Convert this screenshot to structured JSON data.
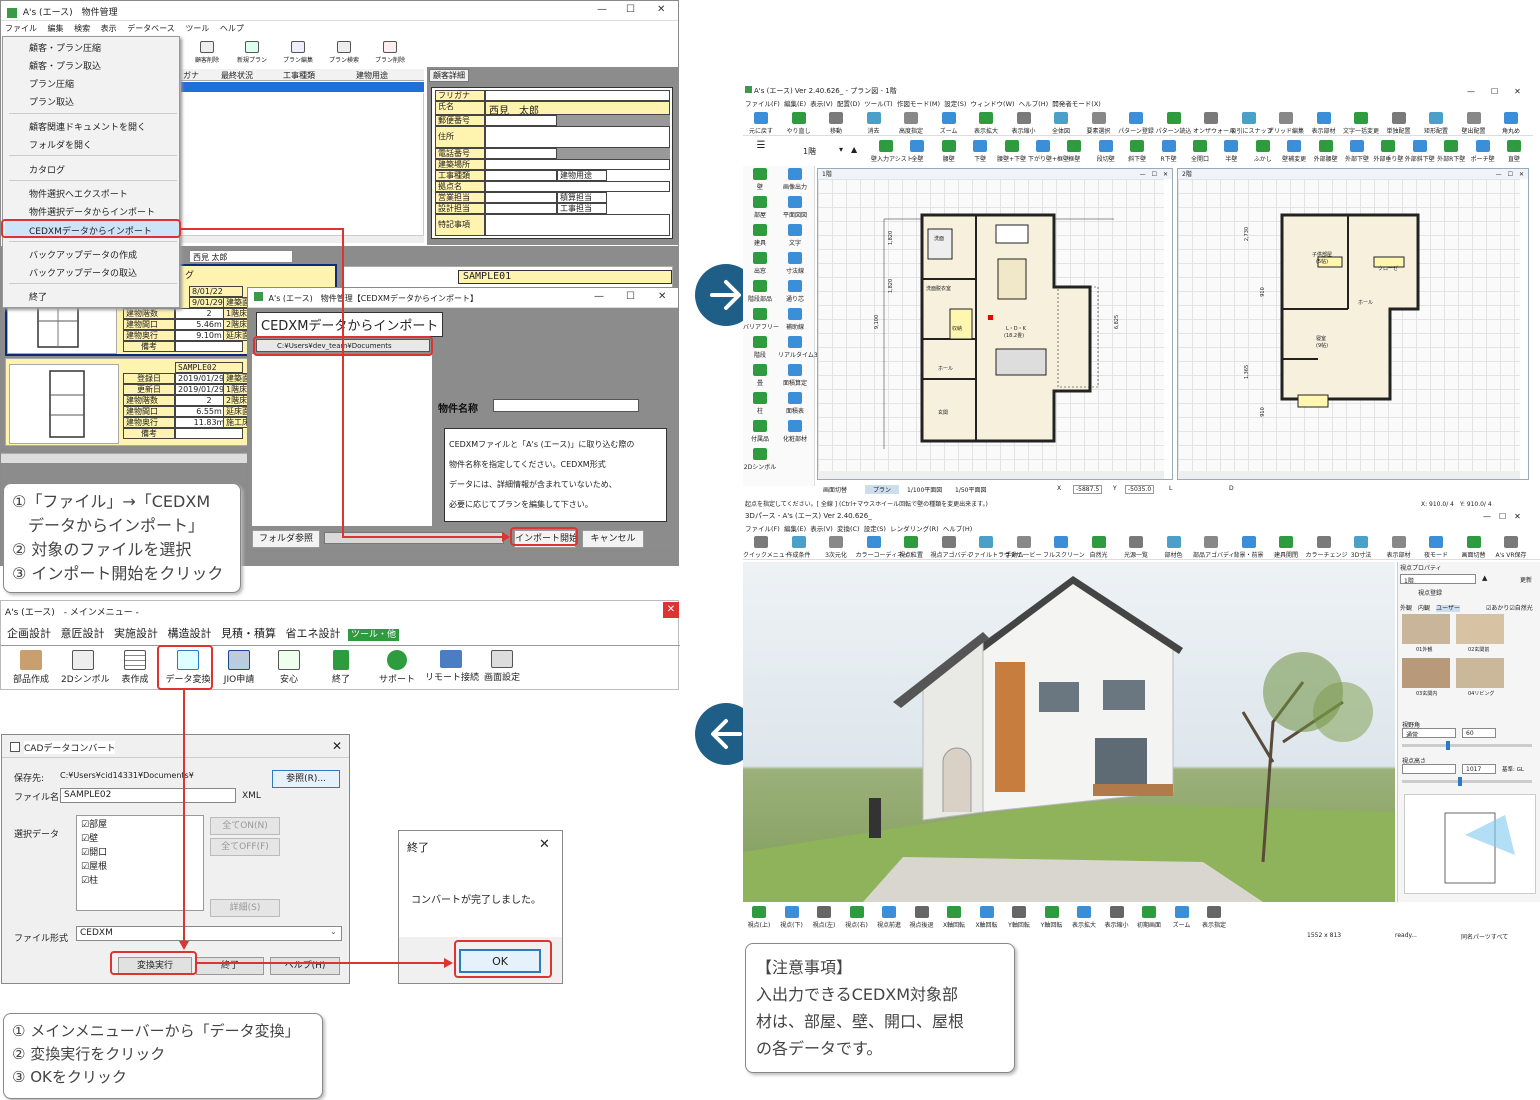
{
  "prop_window": {
    "title": "A's (エース)　物件管理",
    "menus": [
      "ファイル",
      "編集",
      "検索",
      "表示",
      "データベース",
      "ツール",
      "ヘルプ"
    ],
    "file_menu": [
      "顧客・プラン圧縮",
      "顧客・プラン取込",
      "プラン圧縮",
      "プラン取込",
      "顧客関連ドキュメントを開く",
      "フォルダを開く",
      "カタログ",
      "物件選択へエクスポート",
      "物件選択データからインポート",
      "CEDXMデータからインポート",
      "バックアップデータの作成",
      "バックアップデータの取込",
      "終了"
    ],
    "toolbar": [
      "顧客削除",
      "新規プラン",
      "プラン編集",
      "プラン検索",
      "プラン削除"
    ],
    "columns": [
      "ガナ",
      "最終状況",
      "工事種類",
      "建物用途"
    ],
    "detail_tab": "顧客詳細",
    "detail_labels": [
      "フリガナ",
      "氏名",
      "郵便番号",
      "住所",
      "電話番号",
      "建築場所",
      "工事種類",
      "拠点名",
      "営業担当",
      "設計担当",
      "特記事項"
    ],
    "customer_name": "西見　太郎",
    "extra_labels": [
      "建物用途",
      "積算担当",
      "工事担当"
    ],
    "customer_name2": "西見 太郎",
    "plan1": {
      "dates": [
        "8/01/22",
        "9/01/29"
      ],
      "rows": [
        [
          "建物階数",
          "2"
        ],
        [
          "建物間口",
          "5.46m"
        ],
        [
          "建物奥行",
          "9.10m"
        ],
        [
          "備考",
          ""
        ]
      ],
      "side": [
        "建築面",
        "1階床面",
        "2階床面",
        "延床面",
        "施工床"
      ]
    },
    "plan2": {
      "name": "SAMPLE02",
      "rows": [
        [
          "登録日",
          "2019/01/29"
        ],
        [
          "更新日",
          "2019/01/29"
        ],
        [
          "建物階数",
          "2"
        ],
        [
          "建物間口",
          "6.55m"
        ],
        [
          "建物奥行",
          "11.83m"
        ],
        [
          "備考",
          ""
        ]
      ],
      "side": [
        "建築面",
        "1階床面",
        "2階床面",
        "延床面",
        "施工床"
      ]
    },
    "sample01": "SAMPLE01",
    "plan1_tab": "グ"
  },
  "import_dialog": {
    "title": "A's (エース)　物件管理【CEDXMデータからインポート】",
    "heading": "CEDXMデータからインポート",
    "path": "C:¥Users¥dev_team¥Documents",
    "name_label": "物件名称",
    "help": [
      "CEDXMファイルと「A's (エース)」に取り込む際の",
      "物件名称を指定してください。CEDXM形式",
      "データには、詳細情報が含まれていないため、",
      "必要に応じてプランを編集して下さい。"
    ],
    "folder_btn": "フォルダ参照",
    "start_btn": "インポート開始",
    "cancel_btn": "キャンセル"
  },
  "note1": [
    "①「ファイル」→「CEDXM",
    "　データからインポート」",
    "② 対象のファイルを選択",
    "③ インポート開始をクリック"
  ],
  "main_menu": {
    "title": "A's (エース)　- メインメニュー -",
    "tabs": [
      "企画設計",
      "意匠設計",
      "実施設計",
      "構造設計",
      "見積・積算",
      "省エネ設計",
      "ツール・他"
    ],
    "icons": [
      "部品作成",
      "2Dシンボル",
      "表作成",
      "データ変換",
      "JIO申請",
      "安心",
      "終了",
      "サポート",
      "リモート接続",
      "画面設定"
    ]
  },
  "cad_dialog": {
    "title": "CADデータコンバート",
    "save_label": "保存先:",
    "save_path": "C:¥Users¥cid14331¥Documents¥",
    "browse_btn": "参照(R)...",
    "file_label": "ファイル名:",
    "file_value": "SAMPLE02",
    "ext": "XML",
    "select_label": "選択データ",
    "items": [
      "部屋",
      "壁",
      "開口",
      "屋根",
      "柱"
    ],
    "all_on": "全てON(N)",
    "all_off": "全てOFF(F)",
    "detail": "詳細(S)",
    "format_label": "ファイル形式",
    "format_value": "CEDXM",
    "exec_btn": "変換実行",
    "end_btn": "終了",
    "help_btn": "ヘルプ(H)"
  },
  "done_dialog": {
    "title": "終了",
    "message": "コンバートが完了しました。",
    "ok": "OK"
  },
  "note2": [
    "① メインメニューバーから「データ変換」",
    "② 変換実行をクリック",
    "③ OKをクリック"
  ],
  "plan_window": {
    "title": "A's (エース) Ver 2.40.626_ - プラン図 - 1階",
    "menus": [
      "ファイル(F)",
      "編集(E)",
      "表示(V)",
      "配置(D)",
      "ツール(T)",
      "作図モード(M)",
      "設定(S)",
      "ウィンドウ(W)",
      "ヘルプ(H)",
      "開発者モード(X)"
    ],
    "tools": [
      "元に戻す",
      "やり直し",
      "移動",
      "消去",
      "高度指定",
      "ズーム",
      "表示拡大",
      "表示縮小",
      "全体図",
      "要素選択",
      "パターン登録",
      "パターン読込",
      "オンザウォール",
      "吸引にスナップ",
      "ゲリッド編集",
      "表示部材",
      "文字一括変更",
      "単独配置",
      "矩形配置",
      "壁出配置",
      "角丸め"
    ],
    "floor": "1階",
    "walls": [
      "壁入力アシスト",
      "全壁",
      "腰壁",
      "下壁",
      "腰壁+下壁",
      "下がり壁+框壁",
      "框壁",
      "段切壁",
      "斜下壁",
      "R下壁",
      "全開口",
      "半壁",
      "ふかし",
      "壁補変更",
      "外部腰壁",
      "外部下壁",
      "外部垂り壁",
      "外部斜下壁",
      "外部R下壁",
      "ポーチ壁",
      "直壁"
    ],
    "side": [
      "壁",
      "画像出力",
      "部屋",
      "平面図図",
      "建具",
      "文字",
      "出窓",
      "寸法線",
      "階段部品",
      "通り芯",
      "バリアフリー",
      "補助線",
      "階段",
      "リアルタイム3",
      "畳",
      "面積算定",
      "柱",
      "面積表",
      "付属品",
      "化粧部材",
      "2Dシンボル"
    ],
    "pane1": "1階",
    "pane2": "2階",
    "rooms1": [
      "洗面",
      "洗面脱衣室",
      "収納",
      "L・D・K",
      "(18.2畳)",
      "ホール",
      "玄関"
    ],
    "rooms2": [
      "子供部屋",
      "(5帖)",
      "寝室",
      "(9帖)",
      "クローゼ",
      "ホール"
    ],
    "status": [
      "画面切替",
      "プラン",
      "1/100平面図",
      "1/50平面図",
      "X",
      "-5887.5",
      "Y",
      "-5035.0",
      "L",
      "D"
    ],
    "status_hint": "起点を指定してください。[ 全線 ] (Ctrl+マウスホイール回転で壁の種類を変更出来ます。)",
    "coord": "X: 910.0/ 4　Y: 910.0/ 4",
    "dims": [
      "1,820",
      "1,820",
      "910",
      "910",
      "9,100",
      "6,825",
      "2,730",
      "1,365"
    ]
  },
  "perspective": {
    "title": "3Dパース - A's (エース) Ver 2.40.626_",
    "menus": [
      "ファイル(F)",
      "編集(E)",
      "表示(V)",
      "変換(C)",
      "設定(S)",
      "レンダリング(R)",
      "ヘルプ(H)"
    ],
    "tools": [
      "クイックメニュー",
      "作成条件",
      "3次元化",
      "カラーコーディネイト",
      "視点位置",
      "視点アゴバディ",
      "ファイルトラヴァザー",
      "手動ムービー",
      "フルスクリーン",
      "自然光",
      "光源一覧",
      "部材色",
      "部品アゴバディ",
      "背景・前景",
      "建具開閉",
      "カラーチェンジ",
      "3D寸法",
      "表示部材",
      "夜モード",
      "画面切替",
      "A's VR保存"
    ],
    "panel_title": "視点プロパティ",
    "floor": "1階",
    "update": "更新",
    "save": "視点登録",
    "tabs": [
      "外観",
      "内観",
      "ユーザー"
    ],
    "checks": [
      "あかり",
      "自然光"
    ],
    "views": [
      "01外観",
      "02玄関前",
      "03玄関内",
      "04リビング"
    ],
    "angle_label": "視野角",
    "angle_mode": "通常",
    "angle_value": "60",
    "height_label": "視点高さ",
    "height_value": "1017",
    "base": "基準: GL",
    "nav": [
      "視点(上)",
      "視点(下)",
      "視点(左)",
      "視点(右)",
      "視点前進",
      "視点後退",
      "X軸回転",
      "X軸回転",
      "Y軸回転",
      "Y軸回転",
      "表示拡大",
      "表示縮小",
      "初期画面",
      "ズーム",
      "表示指定"
    ],
    "status": [
      "1552 x 813",
      "ready...",
      "同名パーツすべて"
    ]
  },
  "note3": [
    "【注意事項】",
    "入出力できるCEDXM対象部",
    "材は、部屋、壁、開口、屋根",
    "の各データです。"
  ],
  "colors": {
    "accent_red": "#d33",
    "arrow_circle": "#1f5f87"
  }
}
